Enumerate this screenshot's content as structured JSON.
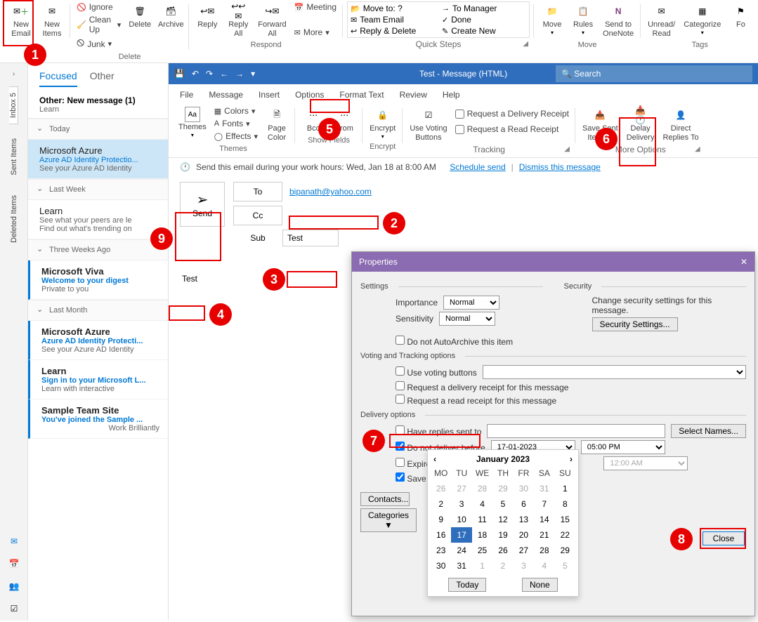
{
  "ribbon": {
    "new_email": "New\nEmail",
    "new_items": "New\nItems",
    "ignore": "Ignore",
    "cleanup": "Clean Up",
    "junk": "Junk",
    "delete": "Delete",
    "archive": "Archive",
    "reply": "Reply",
    "reply_all": "Reply\nAll",
    "forward": "Forward\nAll",
    "meeting": "Meeting",
    "more": "More",
    "move": "Move",
    "rules": "Rules",
    "onenote": "Send to\nOneNote",
    "unread": "Unread/\nRead",
    "categorize": "Categorize",
    "fo": "Fo",
    "grp_delete": "Delete",
    "grp_respond": "Respond",
    "grp_quick": "Quick Steps",
    "grp_move": "Move",
    "grp_tags": "Tags",
    "qs_moveto": "Move to: ?",
    "qs_team": "Team Email",
    "qs_replydel": "Reply & Delete",
    "qs_tomgr": "To Manager",
    "qs_done": "Done",
    "qs_create": "Create New"
  },
  "rail": {
    "inbox": "Inbox 5",
    "sent": "Sent Items",
    "deleted": "Deleted Items"
  },
  "tabs": {
    "focused": "Focused",
    "other": "Other"
  },
  "other_bar": {
    "label": "Other: New message (1)",
    "prev": "Learn"
  },
  "groups": {
    "today": "Today",
    "lastweek": "Last Week",
    "threeweeks": "Three Weeks Ago",
    "lastmonth": "Last Month"
  },
  "items": [
    {
      "from": "Microsoft Azure",
      "sub": "Azure AD Identity Protectio...",
      "prev": "See your Azure AD Identity"
    },
    {
      "from": "Learn",
      "sub": "See what your peers are le",
      "prev": "Find out what's trending on"
    },
    {
      "from": "Microsoft Viva",
      "sub": "Welcome to your digest",
      "prev": "Private to you"
    },
    {
      "from": "Microsoft Azure",
      "sub": "Azure AD Identity Protecti...",
      "prev": "See your Azure AD Identity"
    },
    {
      "from": "Learn",
      "sub": "Sign in to your Microsoft L...",
      "prev": "Learn with interactive"
    },
    {
      "from": "Sample Team Site",
      "sub": "You've joined the Sample ...",
      "prev": "Work Brilliantly"
    }
  ],
  "compose": {
    "title": "Test  -  Message (HTML)",
    "search": "Search",
    "menu": {
      "file": "File",
      "message": "Message",
      "insert": "Insert",
      "options": "Options",
      "format": "Format Text",
      "review": "Review",
      "help": "Help"
    },
    "rgrp": {
      "themes": "Themes",
      "colors": "Colors",
      "fonts": "Fonts",
      "effects": "Effects",
      "pagecolor": "Page\nColor",
      "bcc": "Bcc",
      "from": "From",
      "encrypt": "Encrypt",
      "voting": "Use Voting\nButtons",
      "delivery_r": "Request a Delivery Receipt",
      "read_r": "Request a Read Receipt",
      "saveitem": "Save Sent\nItem To",
      "delay": "Delay\nDelivery",
      "direct": "Direct\nReplies To",
      "g_themes": "Themes",
      "g_show": "Show Fields",
      "g_enc": "Encrypt",
      "g_track": "Tracking",
      "g_more": "More Options"
    },
    "banner": {
      "text": "Send this email during your work hours: Wed, Jan 18 at 8:00 AM",
      "schedule": "Schedule send",
      "dismiss": "Dismiss this message"
    },
    "send": "Send",
    "to": "To",
    "cc": "Cc",
    "subject_lbl": "Sub",
    "to_val": "bipanath@yahoo.com",
    "subject_val": "Test",
    "body": "Test"
  },
  "dialog": {
    "title": "Properties",
    "settings": "Settings",
    "importance": "Importance",
    "sensitivity": "Sensitivity",
    "normal": "Normal",
    "autoarchive": "Do not AutoArchive this item",
    "security": "Security",
    "sec_text": "Change security settings for this message.",
    "sec_btn": "Security Settings...",
    "voting_h": "Voting and Tracking options",
    "use_voting": "Use voting buttons",
    "req_del": "Request a delivery receipt for this message",
    "req_read": "Request a read receipt for this message",
    "delivery_h": "Delivery options",
    "have_replies": "Have replies sent to",
    "select_names": "Select Names...",
    "no_deliver": "Do not deliver before",
    "date1": "17-01-2023",
    "time1": "05:00 PM",
    "expire": "Expire",
    "time2": "12:00 AM",
    "save_c": "Save c",
    "contacts": "Contacts...",
    "categories": "Categories",
    "close": "Close"
  },
  "cal": {
    "month": "January 2023",
    "dow": [
      "MO",
      "TU",
      "WE",
      "TH",
      "FR",
      "SA",
      "SU"
    ],
    "rows": [
      [
        "26",
        "27",
        "28",
        "29",
        "30",
        "31",
        "1"
      ],
      [
        "2",
        "3",
        "4",
        "5",
        "6",
        "7",
        "8"
      ],
      [
        "9",
        "10",
        "11",
        "12",
        "13",
        "14",
        "15"
      ],
      [
        "16",
        "17",
        "18",
        "19",
        "20",
        "21",
        "22"
      ],
      [
        "23",
        "24",
        "25",
        "26",
        "27",
        "28",
        "29"
      ],
      [
        "30",
        "31",
        "1",
        "2",
        "3",
        "4",
        "5"
      ]
    ],
    "sel": "17",
    "today": "Today",
    "none": "None"
  }
}
